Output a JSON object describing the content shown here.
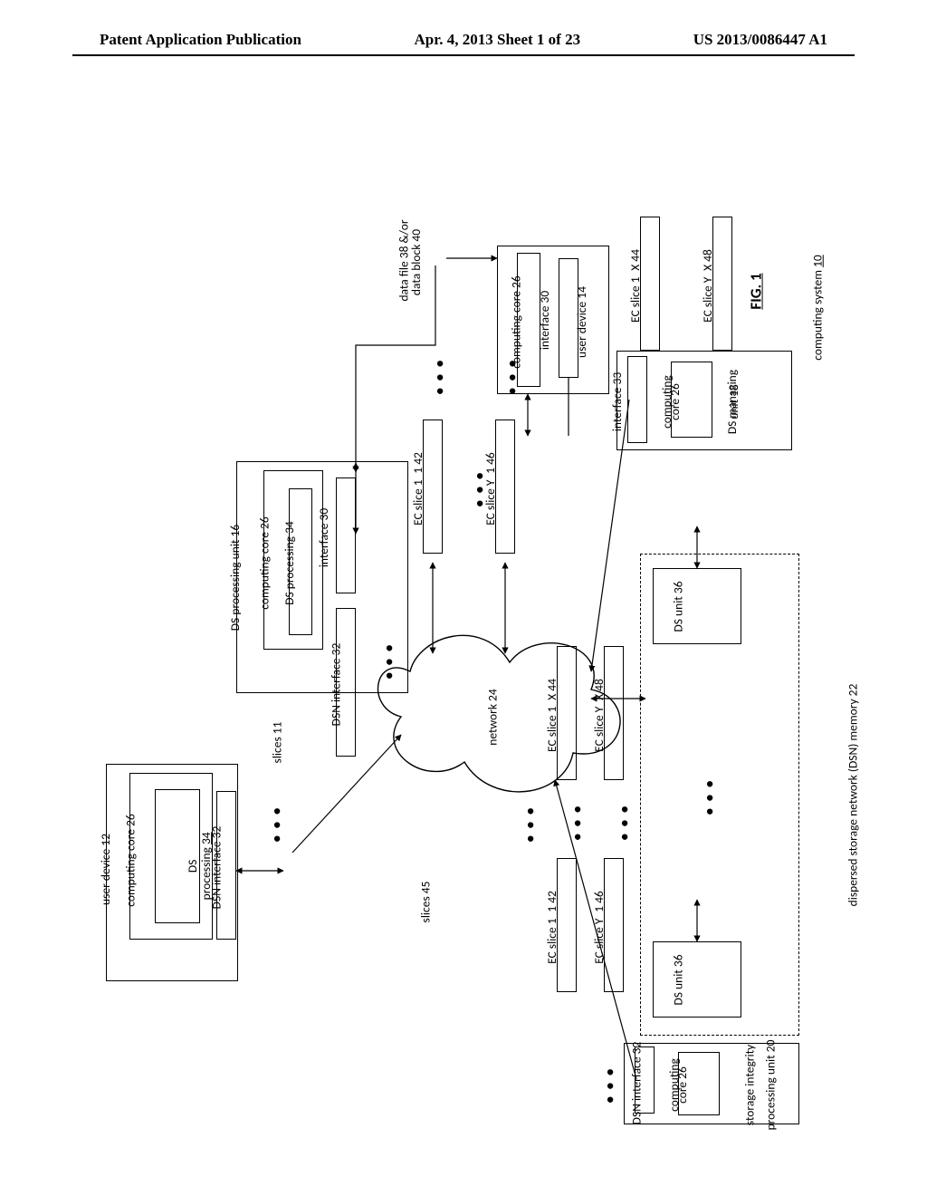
{
  "header": {
    "left": "Patent Application Publication",
    "mid": "Apr. 4, 2013  Sheet 1 of 23",
    "right": "US 2013/0086447 A1"
  },
  "diagram": {
    "fig_label": "FIG. 1",
    "system_label": "computing system 10",
    "system_label_num": "10",
    "user_device_12": "user device 12",
    "user_device_14": "user device 14",
    "computing_core_26": "computing core 26",
    "ds_processing_34": "DS processing 34",
    "ds_processing_34_b": "DS\nprocessing 34",
    "dsn_interface_32": "DSN interface 32",
    "interface_30": "interface 30",
    "interface_33": "interface 33",
    "ds_processing_unit_16": "DS processing unit 16",
    "data_file": "data file 38 &/or",
    "data_block": "data block 40",
    "ec_1_1": "EC slice 1_1 42",
    "ec_1_x": "EC slice 1_X 44",
    "ec_y_1": "EC slice Y_1 46",
    "ec_y_x": "EC slice Y_X 48",
    "slices_11": "slices 11",
    "slices_45": "slices 45",
    "network_24": "network 24",
    "ds_unit_36": "DS unit 36",
    "dsn_memory_22": "dispersed storage network (DSN) memory 22",
    "ds_managing_unit_18": "DS managing unit 18",
    "storage_integrity_unit_20": "storage integrity processing unit 20",
    "storage_integrity_line1": "storage integrity",
    "storage_integrity_line2": "processing unit 20",
    "ds_managing_line1": "DS managing",
    "ds_managing_line2": "unit 18",
    "computing_short": "computing",
    "core_short": "core 26",
    "dots3": "● ● ●"
  }
}
